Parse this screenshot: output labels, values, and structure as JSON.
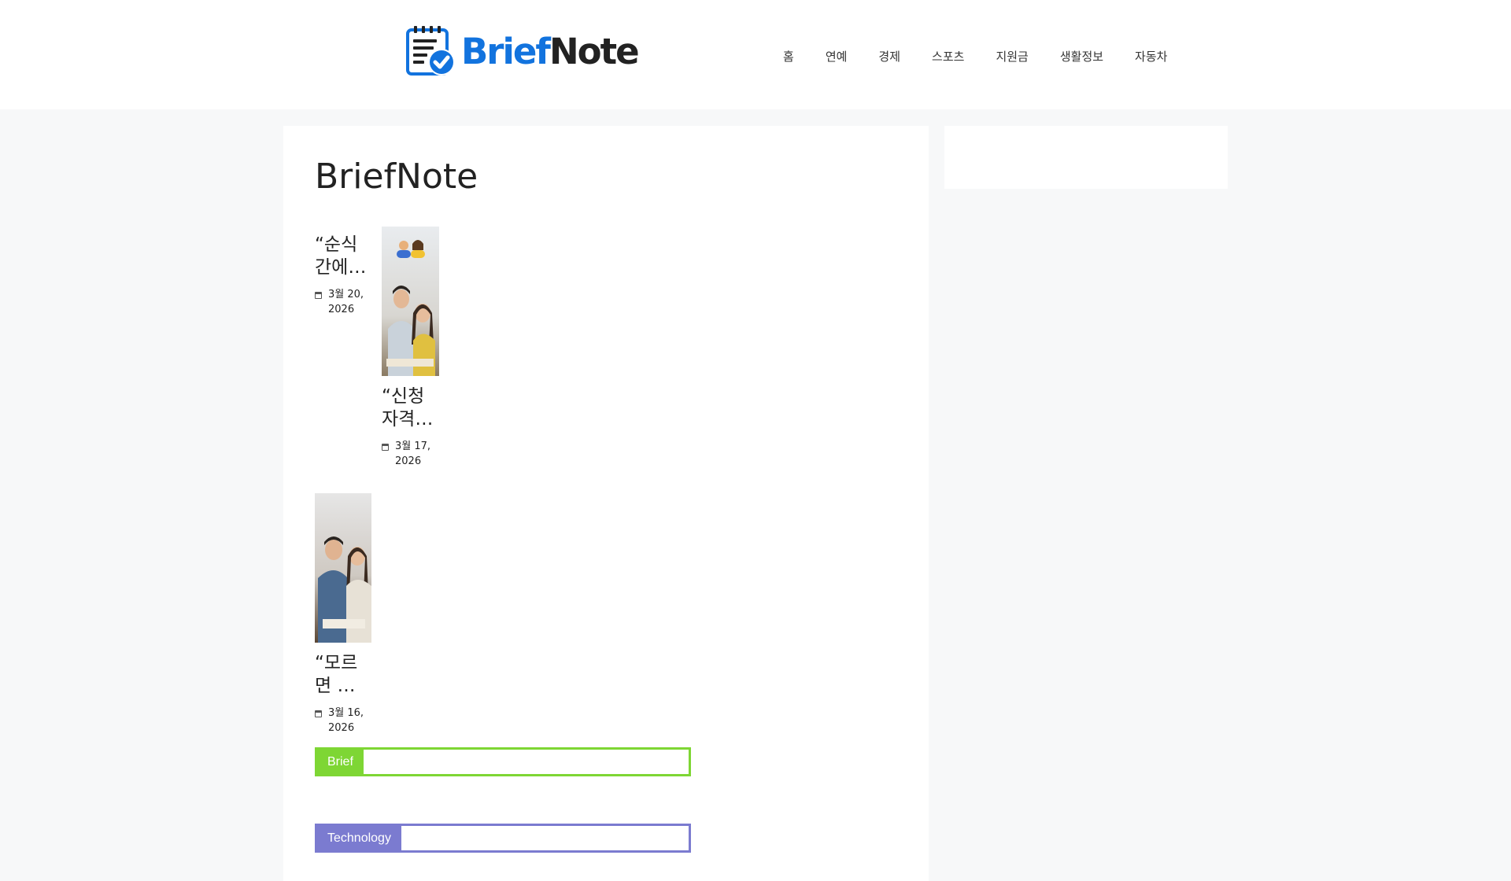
{
  "header": {
    "logo": {
      "brief": "Brief",
      "note": "Note"
    },
    "nav": [
      "홈",
      "연예",
      "경제",
      "스포츠",
      "지원금",
      "생활정보",
      "자동차"
    ]
  },
  "page": {
    "title": "BriefNote"
  },
  "posts": [
    {
      "title_line1": "“순식",
      "title_line2": "간에…",
      "date_line1": "3월 20,",
      "date_line2": "2026"
    },
    {
      "title_line1": "“신청",
      "title_line2": "자격…",
      "date_line1": "3월 17,",
      "date_line2": "2026"
    },
    {
      "title_line1": "“모르",
      "title_line2": "면 …",
      "date_line1": "3월 16,",
      "date_line2": "2026"
    }
  ],
  "categories": [
    {
      "label": "Brief",
      "color": "#7ed634"
    },
    {
      "label": "Technology",
      "color": "#7b7bd0"
    }
  ],
  "colors": {
    "brand_blue": "#1273de",
    "background": "#f7f8f9"
  }
}
